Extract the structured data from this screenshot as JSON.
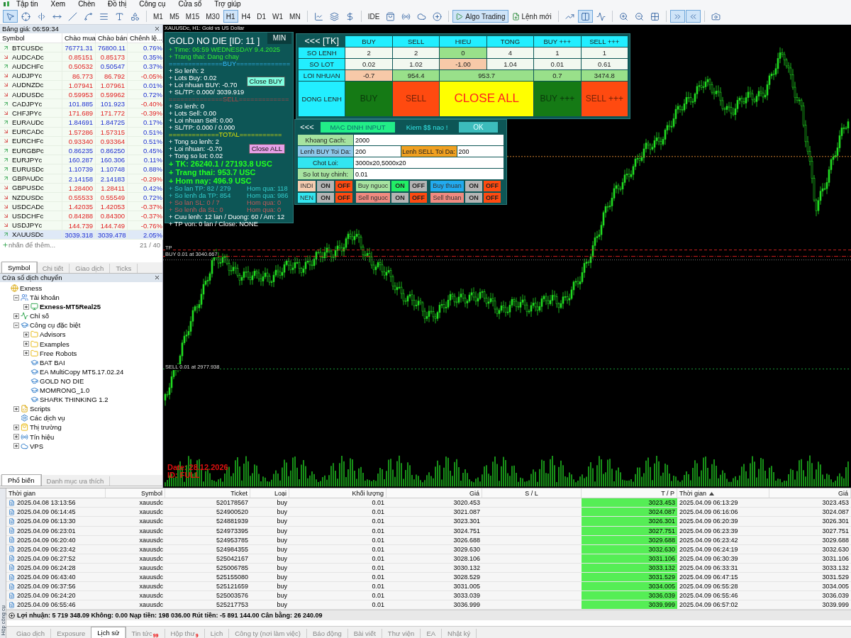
{
  "menu": [
    "Tập tin",
    "Xem",
    "Chèn",
    "Đồ thị",
    "Công cụ",
    "Cửa sổ",
    "Trợ giúp"
  ],
  "toolbar": [
    {
      "kind": "tool",
      "selected": true
    },
    {
      "kind": "tool",
      "selected": false
    },
    {
      "kind": "tool",
      "selected": false
    },
    {
      "kind": "tool",
      "selected": false
    },
    {
      "kind": "tool",
      "selected": false
    },
    {
      "kind": "tool",
      "selected": false
    },
    {
      "kind": "tool",
      "selected": false
    },
    {
      "kind": "tool",
      "selected": false
    },
    {
      "kind": "tool",
      "selected": false
    },
    {
      "kind": "separator"
    },
    {
      "kind": "timeframe",
      "label": "M1",
      "selected": false
    },
    {
      "kind": "timeframe",
      "label": "M5",
      "selected": false
    },
    {
      "kind": "timeframe",
      "label": "M15",
      "selected": false
    },
    {
      "kind": "timeframe",
      "label": "M30",
      "selected": false
    },
    {
      "kind": "timeframe",
      "label": "H1",
      "selected": true
    },
    {
      "kind": "timeframe",
      "label": "H4",
      "selected": false
    },
    {
      "kind": "timeframe",
      "label": "D1",
      "selected": false
    },
    {
      "kind": "timeframe",
      "label": "W1",
      "selected": false
    },
    {
      "kind": "timeframe",
      "label": "MN",
      "selected": false
    },
    {
      "kind": "separator"
    },
    {
      "kind": "tool",
      "selected": false
    },
    {
      "kind": "tool",
      "selected": false
    },
    {
      "kind": "tool",
      "selected": false
    },
    {
      "kind": "separator"
    },
    {
      "kind": "timeframe",
      "label": "IDE",
      "selected": false
    },
    {
      "kind": "tool",
      "selected": false
    },
    {
      "kind": "tool",
      "selected": false
    },
    {
      "kind": "tool",
      "selected": false
    },
    {
      "kind": "tool",
      "selected": false
    },
    {
      "kind": "separator"
    },
    {
      "kind": "button",
      "label": "Algo Trading",
      "selected": true
    },
    {
      "kind": "button",
      "label": "Lệnh mới",
      "selected": false
    },
    {
      "kind": "separator"
    },
    {
      "kind": "tool",
      "selected": false
    },
    {
      "kind": "tool",
      "selected": true
    },
    {
      "kind": "tool",
      "selected": false
    },
    {
      "kind": "separator"
    },
    {
      "kind": "tool",
      "selected": false
    },
    {
      "kind": "tool",
      "selected": false
    },
    {
      "kind": "tool",
      "selected": false
    },
    {
      "kind": "separator"
    },
    {
      "kind": "tool",
      "selected": true
    },
    {
      "kind": "tool",
      "selected": true
    },
    {
      "kind": "separator"
    },
    {
      "kind": "tool",
      "selected": false
    }
  ],
  "market_watch": {
    "title": "Bảng giá: 06:59:34",
    "columns": [
      "Symbol",
      "Chào mua",
      "Chào bán",
      "Chênh lệ..."
    ],
    "rows": [
      {
        "symbol": "BTCUSDc",
        "bid": "76771.31",
        "ask": "76800.11",
        "change": "0.76%",
        "up": true,
        "bid_up": true,
        "ask_up": true,
        "change_up": true,
        "selected": false
      },
      {
        "symbol": "AUDCADc",
        "bid": "0.85151",
        "ask": "0.85173",
        "change": "0.35%",
        "up": false,
        "bid_up": false,
        "ask_up": false,
        "change_up": true,
        "selected": false
      },
      {
        "symbol": "AUDCHFc",
        "bid": "0.50532",
        "ask": "0.50547",
        "change": "0.37%",
        "up": true,
        "bid_up": false,
        "ask_up": true,
        "change_up": true,
        "selected": false
      },
      {
        "symbol": "AUDJPYc",
        "bid": "86.773",
        "ask": "86.792",
        "change": "-0.05%",
        "up": false,
        "bid_up": false,
        "ask_up": false,
        "change_up": false,
        "selected": false
      },
      {
        "symbol": "AUDNZDc",
        "bid": "1.07941",
        "ask": "1.07961",
        "change": "0.01%",
        "up": false,
        "bid_up": false,
        "ask_up": false,
        "change_up": true,
        "selected": false
      },
      {
        "symbol": "AUDUSDc",
        "bid": "0.59953",
        "ask": "0.59962",
        "change": "0.72%",
        "up": false,
        "bid_up": false,
        "ask_up": false,
        "change_up": true,
        "selected": false
      },
      {
        "symbol": "CADJPYc",
        "bid": "101.885",
        "ask": "101.923",
        "change": "-0.40%",
        "up": true,
        "bid_up": true,
        "ask_up": true,
        "change_up": false,
        "selected": false
      },
      {
        "symbol": "CHFJPYc",
        "bid": "171.689",
        "ask": "171.772",
        "change": "-0.39%",
        "up": false,
        "bid_up": false,
        "ask_up": false,
        "change_up": false,
        "selected": false
      },
      {
        "symbol": "EURAUDc",
        "bid": "1.84691",
        "ask": "1.84725",
        "change": "0.17%",
        "up": true,
        "bid_up": true,
        "ask_up": true,
        "change_up": true,
        "selected": false
      },
      {
        "symbol": "EURCADc",
        "bid": "1.57286",
        "ask": "1.57315",
        "change": "0.51%",
        "up": false,
        "bid_up": false,
        "ask_up": false,
        "change_up": true,
        "selected": false
      },
      {
        "symbol": "EURCHFc",
        "bid": "0.93340",
        "ask": "0.93364",
        "change": "0.51%",
        "up": false,
        "bid_up": false,
        "ask_up": false,
        "change_up": true,
        "selected": false
      },
      {
        "symbol": "EURGBPc",
        "bid": "0.86235",
        "ask": "0.86250",
        "change": "0.45%",
        "up": true,
        "bid_up": true,
        "ask_up": true,
        "change_up": true,
        "selected": false
      },
      {
        "symbol": "EURJPYc",
        "bid": "160.287",
        "ask": "160.306",
        "change": "0.11%",
        "up": true,
        "bid_up": true,
        "ask_up": true,
        "change_up": true,
        "selected": false
      },
      {
        "symbol": "EURUSDc",
        "bid": "1.10739",
        "ask": "1.10748",
        "change": "0.88%",
        "up": true,
        "bid_up": true,
        "ask_up": true,
        "change_up": true,
        "selected": false
      },
      {
        "symbol": "GBPAUDc",
        "bid": "2.14158",
        "ask": "2.14183",
        "change": "-0.29%",
        "up": true,
        "bid_up": true,
        "ask_up": true,
        "change_up": false,
        "selected": false
      },
      {
        "symbol": "GBPUSDc",
        "bid": "1.28400",
        "ask": "1.28411",
        "change": "0.42%",
        "up": false,
        "bid_up": false,
        "ask_up": false,
        "change_up": true,
        "selected": false
      },
      {
        "symbol": "NZDUSDc",
        "bid": "0.55533",
        "ask": "0.55549",
        "change": "0.72%",
        "up": false,
        "bid_up": false,
        "ask_up": false,
        "change_up": true,
        "selected": false
      },
      {
        "symbol": "USDCADc",
        "bid": "1.42035",
        "ask": "1.42053",
        "change": "-0.37%",
        "up": false,
        "bid_up": false,
        "ask_up": false,
        "change_up": false,
        "selected": false
      },
      {
        "symbol": "USDCHFc",
        "bid": "0.84288",
        "ask": "0.84300",
        "change": "-0.37%",
        "up": false,
        "bid_up": false,
        "ask_up": false,
        "change_up": false,
        "selected": false
      },
      {
        "symbol": "USDJPYc",
        "bid": "144.739",
        "ask": "144.749",
        "change": "-0.76%",
        "up": false,
        "bid_up": false,
        "ask_up": false,
        "change_up": false,
        "selected": false
      },
      {
        "symbol": "XAUUSDc",
        "bid": "3039.318",
        "ask": "3039.478",
        "change": "2.05%",
        "up": true,
        "bid_up": true,
        "ask_up": true,
        "change_up": true,
        "selected": true
      }
    ],
    "add_hint": "nhấn để thêm...",
    "count": "21 / 40",
    "tabs": [
      {
        "label": "Symbol",
        "selected": true
      },
      {
        "label": "Chi tiết",
        "selected": false
      },
      {
        "label": "Giao dịch",
        "selected": false
      },
      {
        "label": "Ticks",
        "selected": false
      }
    ]
  },
  "navigator": {
    "title": "Cửa sổ dịch chuyển",
    "tree": [
      {
        "label": "Exness",
        "kind": "root",
        "children": [
          {
            "label": "Tài khoản",
            "kind": "accounts",
            "expanded": true,
            "children": [
              {
                "label": "Exness-MT5Real25",
                "kind": "account",
                "expanded": false
              }
            ]
          },
          {
            "label": "Chỉ số",
            "kind": "indicators",
            "expanded": false
          },
          {
            "label": "Công cụ đặc biệt",
            "kind": "experts",
            "expanded": true,
            "children": [
              {
                "label": "Advisors",
                "kind": "folder",
                "expanded": false
              },
              {
                "label": "Examples",
                "kind": "folder",
                "expanded": false
              },
              {
                "label": "Free Robots",
                "kind": "folder",
                "expanded": false
              },
              {
                "label": "BAT BAI",
                "kind": "expert"
              },
              {
                "label": "EA MultiCopy MT5.17.02.24",
                "kind": "expert"
              },
              {
                "label": "GOLD NO DIE",
                "kind": "expert"
              },
              {
                "label": "MOMRONG_1.0",
                "kind": "expert"
              },
              {
                "label": "SHARK THINKING 1.2",
                "kind": "expert"
              }
            ]
          },
          {
            "label": "Scripts",
            "kind": "scripts",
            "expanded": false
          },
          {
            "label": "Các dịch vụ",
            "kind": "services"
          },
          {
            "label": "Thị trường",
            "kind": "market",
            "expanded": false
          },
          {
            "label": "Tín hiệu",
            "kind": "signals",
            "expanded": false
          },
          {
            "label": "VPS",
            "kind": "vps",
            "expanded": false
          }
        ]
      }
    ],
    "tabs": [
      {
        "label": "Phổ biến",
        "selected": true
      },
      {
        "label": "Danh mục ưa thích",
        "selected": false
      }
    ]
  },
  "chart": {
    "title": "XAUUSDc, H1:  Gold vs US Dollar",
    "levels": [
      {
        "kind": "tp",
        "text": "TP"
      },
      {
        "kind": "buy",
        "text": "BUY 0.01 at 3040.667"
      },
      {
        "kind": "sell",
        "text": "SELL 0.01 at 2977.938"
      }
    ],
    "date_label": "Date: 28.12.2026",
    "id_label": "ID: FULL"
  },
  "ea_panel": {
    "title": "GOLD NO DIE  [ID: 11 ]",
    "min_button": "MIN",
    "header_lines": [
      "+ Time: 06:59 WEDNESDAY 9.4.2025",
      "+ Trang thai: Dang chay"
    ],
    "sections": [
      {
        "divider": "==============BUY==============",
        "lines": [
          "+ So lenh: 2",
          "+ Lots Buy: 0.02",
          "+ Loi nhuan BUY: -0.70",
          "+ SL/TP: 0.000/ 3039.919"
        ],
        "button": "Close BUY"
      },
      {
        "divider": "==============SELL=============",
        "lines": [
          "+ So lenh: 0",
          "+ Lots Sell: 0.00",
          "+ Loi nhuan Sell: 0.00",
          "+ SL/TP: 0.000 / 0.000"
        ]
      },
      {
        "divider": "=============TOTAL===========",
        "lines": [
          "+ Tong so lenh: 2",
          "+ Loi nhuan: -0.70",
          "+ Tong so lot: 0.02"
        ],
        "button": "Close ALL"
      }
    ],
    "big_lines": [
      "+ TK: 26240.1 / 27193.8 USC",
      "+ Trang thai: 953.7 USC",
      "+ Hom nay: 496.9 USC"
    ],
    "stat_lines": [
      {
        "left": "+ So lan TP: 82 / 279",
        "right": "Hom qua: 118"
      },
      {
        "left": "+ So lenh da TP: 854",
        "right": "Hom qua: 986"
      },
      {
        "left": "+ So lan SL: 0 / 7",
        "right": "Hom qua: 0"
      },
      {
        "left": "+ So lenh da SL: 0",
        "right": "Hom qua: 0"
      }
    ],
    "footer_lines": [
      "+ Cuu lenh: 12 lan / Duong: 60 / Am: 12",
      "+ TP von: 0 lan / Close: NONE"
    ]
  },
  "tk_table": {
    "corner": "<<<  [TK]",
    "columns": [
      "BUY",
      "SELL",
      "HIEU",
      "TONG",
      "BUY +++",
      "SELL +++"
    ],
    "rows": [
      {
        "label": "SO LENH",
        "cells": [
          {
            "text": "2",
            "color": "#f2f8f0"
          },
          {
            "text": "2",
            "color": "#f2f8f0"
          },
          {
            "text": "0",
            "color": "#99e08a"
          },
          {
            "text": "4",
            "color": "#f2f8f0"
          },
          {
            "text": "1",
            "color": "#f2f8f0"
          },
          {
            "text": "1",
            "color": "#f2f8f0"
          }
        ]
      },
      {
        "label": "SO LOT",
        "cells": [
          {
            "text": "0.02",
            "color": "#f2f8f0"
          },
          {
            "text": "1.02",
            "color": "#f2f8f0"
          },
          {
            "text": "-1.00",
            "color": "#f7c9a8"
          },
          {
            "text": "1.04",
            "color": "#f2f8f0"
          },
          {
            "text": "0.01",
            "color": "#f2f8f0"
          },
          {
            "text": "0.61",
            "color": "#f2f8f0"
          }
        ]
      },
      {
        "label": "LOI NHUAN",
        "cells": [
          {
            "text": "-0.7",
            "color": "#f7c9a8"
          },
          {
            "text": "954.4",
            "color": "#99e08a"
          },
          {
            "text": "953.7",
            "color": "#99e08a"
          },
          null,
          {
            "text": "0.7",
            "color": "#99e08a"
          },
          {
            "text": "3474.8",
            "color": "#99e08a"
          }
        ]
      }
    ],
    "action_label": "DONG LENH",
    "actions": [
      {
        "label": "BUY",
        "color": "#157a15",
        "wide": false
      },
      {
        "label": "SELL",
        "color": "#ff4a10",
        "wide": false
      },
      {
        "label": "CLOSE ALL",
        "color": "#ffff00",
        "wide": true
      },
      {
        "label": "BUY +++",
        "color": "#157a15",
        "wide": false
      },
      {
        "label": "SELL +++",
        "color": "#ff4a10",
        "wide": false
      }
    ]
  },
  "input_panel": {
    "back": "<<<",
    "default_button": "MAC DINH INPUT",
    "slogan": "Kiem $$ nao !",
    "ok_button": "OK",
    "field_rows": [
      [
        {
          "label": "Khoang Cach:",
          "value": "2000",
          "color": "#a6e3a0"
        }
      ],
      [
        {
          "label": "Lenh BUY Toi Da:",
          "value": "200",
          "color": "#8ec8ea"
        },
        {
          "label": "Lenh SELL Toi Da:",
          "value": "200",
          "color": "#f0a020"
        }
      ],
      [
        {
          "label": "Chot Loi:",
          "value": "3000x20,5000x20",
          "color": "#33e6f0"
        }
      ],
      [
        {
          "label": "So lot tuy chinh:",
          "value": "0.01",
          "color": "#a6e3a0"
        }
      ]
    ],
    "toggle_rows": [
      [
        {
          "label": "INDI",
          "color": "#f5cdb0",
          "on": false,
          "on_text": "ON",
          "off_text": "OFF"
        },
        {
          "label": "Buy nguoc",
          "color": "#a6e3a0",
          "on": true,
          "on_text": "ON",
          "off_text": "OFF"
        },
        {
          "label": "Buy thuan",
          "color": "#22aaee",
          "on": false,
          "on_text": "ON",
          "off_text": "OFF"
        }
      ],
      [
        {
          "label": "NEN",
          "color": "#33e6f0",
          "on": false,
          "on_text": "ON",
          "off_text": "OFF"
        },
        {
          "label": "Sell nguoc",
          "color": "#f08a80",
          "on": false,
          "on_text": "ON",
          "off_text": "OFF"
        },
        {
          "label": "Sell thuan",
          "color": "#f08a80",
          "on": false,
          "on_text": "ON",
          "off_text": "OFF"
        }
      ]
    ]
  },
  "toolbox": {
    "side_label": "Hộp công cụ",
    "columns": [
      {
        "label": "Thời gian",
        "sorted": false
      },
      {
        "label": "Symbol",
        "sorted": false
      },
      {
        "label": "Ticket",
        "sorted": false
      },
      {
        "label": "Loại",
        "sorted": false
      },
      {
        "label": "Khối lượng",
        "sorted": false
      },
      {
        "label": "Giá",
        "sorted": false
      },
      {
        "label": "S / L",
        "sorted": false
      },
      {
        "label": "T / P",
        "sorted": false
      },
      {
        "label": "Thời gian",
        "sorted": true
      },
      {
        "label": "Giá",
        "sorted": false
      }
    ],
    "rows": [
      {
        "open_time": "2025.04.08 13:13:56",
        "symbol": "xauusdc",
        "ticket": "520178567",
        "type": "buy",
        "volume": "0.01",
        "price": "3020.453",
        "tp": "3023.453",
        "close_time": "2025.04.09 06:13:29",
        "close_price": "3023.453"
      },
      {
        "open_time": "2025.04.09 06:14:45",
        "symbol": "xauusdc",
        "ticket": "524900520",
        "type": "buy",
        "volume": "0.01",
        "price": "3021.087",
        "tp": "3024.087",
        "close_time": "2025.04.09 06:16:06",
        "close_price": "3024.087"
      },
      {
        "open_time": "2025.04.09 06:13:30",
        "symbol": "xauusdc",
        "ticket": "524881939",
        "type": "buy",
        "volume": "0.01",
        "price": "3023.301",
        "tp": "3026.301",
        "close_time": "2025.04.09 06:20:39",
        "close_price": "3026.301"
      },
      {
        "open_time": "2025.04.09 06:23:01",
        "symbol": "xauusdc",
        "ticket": "524973395",
        "type": "buy",
        "volume": "0.01",
        "price": "3024.751",
        "tp": "3027.751",
        "close_time": "2025.04.09 06:23:39",
        "close_price": "3027.751"
      },
      {
        "open_time": "2025.04.09 06:20:40",
        "symbol": "xauusdc",
        "ticket": "524953785",
        "type": "buy",
        "volume": "0.01",
        "price": "3026.688",
        "tp": "3029.688",
        "close_time": "2025.04.09 06:23:42",
        "close_price": "3029.688"
      },
      {
        "open_time": "2025.04.09 06:23:42",
        "symbol": "xauusdc",
        "ticket": "524984355",
        "type": "buy",
        "volume": "0.01",
        "price": "3029.630",
        "tp": "3032.630",
        "close_time": "2025.04.09 06:24:19",
        "close_price": "3032.630"
      },
      {
        "open_time": "2025.04.09 06:27:52",
        "symbol": "xauusdc",
        "ticket": "525042167",
        "type": "buy",
        "volume": "0.01",
        "price": "3028.106",
        "tp": "3031.106",
        "close_time": "2025.04.09 06:30:39",
        "close_price": "3031.106"
      },
      {
        "open_time": "2025.04.09 06:24:28",
        "symbol": "xauusdc",
        "ticket": "525006785",
        "type": "buy",
        "volume": "0.01",
        "price": "3030.132",
        "tp": "3033.132",
        "close_time": "2025.04.09 06:33:31",
        "close_price": "3033.132"
      },
      {
        "open_time": "2025.04.09 06:43:40",
        "symbol": "xauusdc",
        "ticket": "525155080",
        "type": "buy",
        "volume": "0.01",
        "price": "3028.529",
        "tp": "3031.529",
        "close_time": "2025.04.09 06:47:15",
        "close_price": "3031.529"
      },
      {
        "open_time": "2025.04.09 06:37:56",
        "symbol": "xauusdc",
        "ticket": "525121659",
        "type": "buy",
        "volume": "0.01",
        "price": "3031.005",
        "tp": "3034.005",
        "close_time": "2025.04.09 06:55:28",
        "close_price": "3034.005"
      },
      {
        "open_time": "2025.04.09 06:24:20",
        "symbol": "xauusdc",
        "ticket": "525003576",
        "type": "buy",
        "volume": "0.01",
        "price": "3033.039",
        "tp": "3036.039",
        "close_time": "2025.04.09 06:55:46",
        "close_price": "3036.039"
      },
      {
        "open_time": "2025.04.09 06:55:46",
        "symbol": "xauusdc",
        "ticket": "525217753",
        "type": "buy",
        "volume": "0.01",
        "price": "3036.999",
        "tp": "3039.999",
        "close_time": "2025.04.09 06:57:02",
        "close_price": "3039.999"
      }
    ],
    "summary": "Lợi nhuận: 5 719 348.09  Không: 0.00  Nạp tiền: 198 036.00  Rút tiền: -5 891 144.00  Cân bằng: 26 240.09",
    "tabs": [
      {
        "label": "Giao dịch",
        "selected": false
      },
      {
        "label": "Exposure",
        "selected": false
      },
      {
        "label": "Lịch sử",
        "selected": true
      },
      {
        "label": "Tin tức",
        "badge": "99",
        "selected": false
      },
      {
        "label": "Hộp thư",
        "badge": "9",
        "selected": false
      },
      {
        "label": "Lịch",
        "selected": false
      },
      {
        "label": "Công ty (nơi làm việc)",
        "selected": false
      },
      {
        "label": "Báo động",
        "selected": false
      },
      {
        "label": "Bài viết",
        "selected": false
      },
      {
        "label": "Thư viện",
        "selected": false
      },
      {
        "label": "EA",
        "selected": false
      },
      {
        "label": "Nhật ký",
        "selected": false
      }
    ]
  }
}
